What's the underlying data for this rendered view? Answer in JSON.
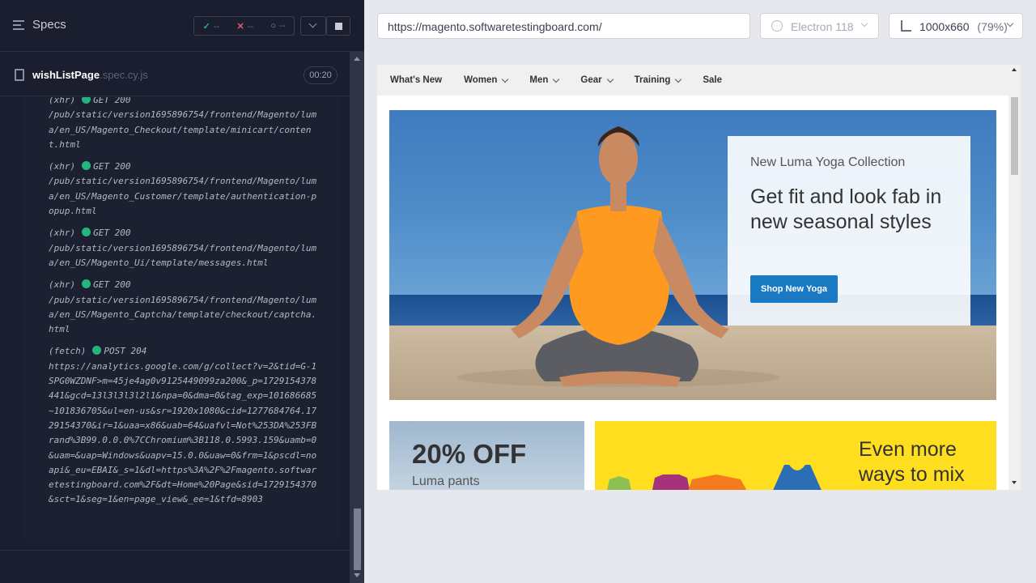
{
  "runner": {
    "specs_label": "Specs",
    "stats": {
      "passed": "--",
      "failed": "--",
      "pending": "--"
    },
    "spec": {
      "name": "wishListPage",
      "ext": ".spec.cy.js",
      "timer": "00:20"
    },
    "log": [
      {
        "type": "(xhr)",
        "method": "GET 200",
        "url": "/pub/static/version1695896754/frontend/Magento/luma/en_US/Magento_Checkout/template/minicart/content.html"
      },
      {
        "type": "(xhr)",
        "method": "GET 200",
        "url": "/pub/static/version1695896754/frontend/Magento/luma/en_US/Magento_Customer/template/authentication-popup.html"
      },
      {
        "type": "(xhr)",
        "method": "GET 200",
        "url": "/pub/static/version1695896754/frontend/Magento/luma/en_US/Magento_Ui/template/messages.html"
      },
      {
        "type": "(xhr)",
        "method": "GET 200",
        "url": "/pub/static/version1695896754/frontend/Magento/luma/en_US/Magento_Captcha/template/checkout/captcha.html"
      },
      {
        "type": "(fetch)",
        "method": "POST 204",
        "url": "https://analytics.google.com/g/collect?v=2&tid=G-1SPG0WZDNF>m=45je4ag0v9125449099za200&_p=1729154378441&gcd=13l3l3l3l2l1&npa=0&dma=0&tag_exp=101686685~101836705&ul=en-us&sr=1920x1080&cid=1277684764.1729154370&ir=1&uaa=x86&uab=64&uafvl=Not%253DA%253FBrand%3B99.0.0.0%7CChromium%3B118.0.5993.159&uamb=0&uam=&uap=Windows&uapv=15.0.0&uaw=0&frm=1&pscdl=noapi&_eu=EBAI&_s=1&dl=https%3A%2F%2Fmagento.softwaretestingboard.com%2F&dt=Home%20Page&sid=1729154370&sct=1&seg=1&en=page_view&_ee=1&tfd=8903"
      }
    ]
  },
  "aut": {
    "url": "https://magento.softwaretestingboard.com/",
    "browser": "Electron 118",
    "viewport": "1000x660",
    "zoom": "(79%)"
  },
  "site": {
    "nav": [
      {
        "label": "What's New",
        "has_chevron": false
      },
      {
        "label": "Women",
        "has_chevron": true
      },
      {
        "label": "Men",
        "has_chevron": true
      },
      {
        "label": "Gear",
        "has_chevron": true
      },
      {
        "label": "Training",
        "has_chevron": true
      },
      {
        "label": "Sale",
        "has_chevron": false
      }
    ],
    "hero": {
      "eyebrow": "New Luma Yoga Collection",
      "headline": "Get fit and look fab in new seasonal styles",
      "button": "Shop New Yoga"
    },
    "tile1": {
      "big": "20% OFF",
      "small": "Luma pants"
    },
    "tile2": {
      "text": "Even more ways to mix"
    }
  },
  "colors": {
    "passed": "#24b47e",
    "failed": "#e45770",
    "accent": "#1979c3",
    "tile_yellow": "#ffdd1f"
  }
}
